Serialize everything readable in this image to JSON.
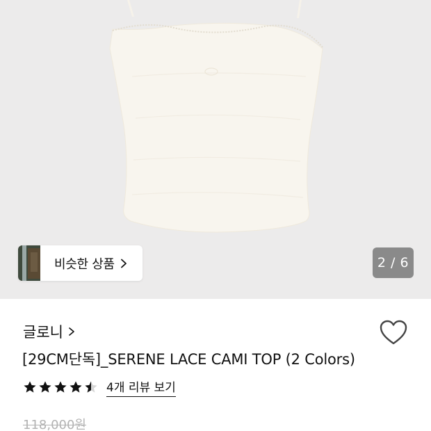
{
  "gallery": {
    "similar_label": "비슷한 상품",
    "counter": "2 / 6"
  },
  "product": {
    "brand": "글로니",
    "title": "[29CM단독]_SERENE LACE CAMI TOP (2 Colors)",
    "rating_stars": 4.5,
    "review_link": "4개 리뷰 보기",
    "original_price": "118,000원"
  },
  "icons": {
    "similar_chevron": "chevron-right-icon",
    "brand_chevron": "chevron-right-icon",
    "wishlist": "heart-outline-icon",
    "star": "star-icon"
  },
  "colors": {
    "gallery_bg": "#ecebeb",
    "counter_bg": "#8a8a8a",
    "price_strike": "#b3b3b3",
    "top_fabric": "#f8f5ee"
  }
}
